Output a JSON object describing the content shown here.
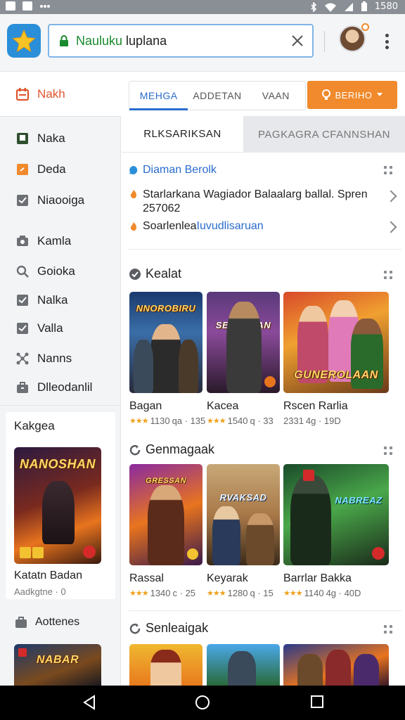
{
  "status_bar": {
    "time": "1580"
  },
  "address_bar": {
    "url_green": "Nauluku",
    "url_rest": " luplana"
  },
  "sidebar": {
    "header": "Nakh",
    "items": [
      {
        "label": "Naka",
        "icon": "bookmark-icon"
      },
      {
        "label": "Deda",
        "icon": "orange-square-icon"
      },
      {
        "label": "Niaooiga",
        "icon": "check-box-icon"
      },
      {
        "label": "Kamla",
        "icon": "camera-icon"
      },
      {
        "label": "Goioka",
        "icon": "search-icon"
      },
      {
        "label": "Nalka",
        "icon": "check-box-icon"
      },
      {
        "label": "Valla",
        "icon": "check-box-icon"
      },
      {
        "label": "Nanns",
        "icon": "network-icon"
      },
      {
        "label": "Dlleodanlil",
        "icon": "briefcase-icon"
      }
    ],
    "card1": {
      "title": "Kakgea",
      "art_title": "NANOSHAN",
      "name": "Katatn Badan",
      "sub": "Aadkgtne · 0"
    },
    "card2": {
      "title": "Aottenes",
      "art_title": "NABAR"
    }
  },
  "main": {
    "tabs": [
      "MEHGA",
      "ADDETAN",
      "VAAN"
    ],
    "orange_button": "BERIHO",
    "segments": [
      "RLKSARIKSAN",
      "PAGKAGRA CFANNSHAN"
    ],
    "news": [
      {
        "text": "Diaman Berolk",
        "color": "#2a6ccd"
      },
      {
        "text": "Starlarkana Wagiador Balaalarg ballal. Spren 257062",
        "color": "#222222"
      },
      {
        "text_prefix": "Soarlenlea",
        "text_link": "Iuvudlisaruan"
      }
    ],
    "sections": [
      {
        "title": "Kealat",
        "games": [
          {
            "name": "Bagan",
            "rating": "1130",
            "meta": "qa · 135",
            "art_title": "NNOROBIRU"
          },
          {
            "name": "Kacea",
            "rating": "1540",
            "meta": "q · 33",
            "art_title": "SEGRDAAN"
          },
          {
            "name": "Rscen Rarlia",
            "rating": "2331",
            "meta": "4g · 19D",
            "art_title": "GUNEROLAAN"
          }
        ]
      },
      {
        "title": "Genmagaak",
        "games": [
          {
            "name": "Rassal",
            "rating": "1340",
            "meta": "c · 25",
            "art_title": "GRESSAN"
          },
          {
            "name": "Keyarak",
            "rating": "1280",
            "meta": "q · 15",
            "art_title": "RVAKSAD"
          },
          {
            "name": "Barrlar Bakka",
            "rating": "1140",
            "meta": "4g · 40D",
            "art_title": "NABREAZ"
          }
        ]
      },
      {
        "title": "Senleaigak"
      }
    ]
  },
  "colors": {
    "accent_blue": "#2a6ccd",
    "accent_orange": "#f08a2c",
    "sidebar_bg": "#f3f4f6"
  }
}
